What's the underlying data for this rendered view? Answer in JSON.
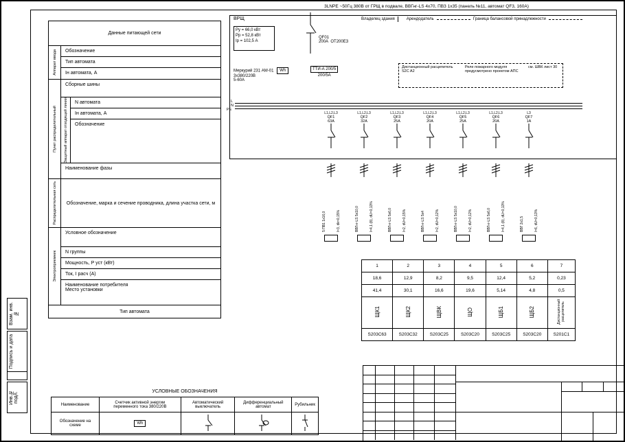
{
  "top_note": "3LNPE ~50Гц 380В от ГРЩ в подвале, ВВГнг-LS 4x70, ПВЗ 1x35 (панель №11, автомат QF3, 160А)",
  "vrd": "ВРЩ",
  "owner": {
    "left": "Владелец здания",
    "right": "Арендодатель",
    "line": "Граница балансовой принадлежности"
  },
  "params": {
    "pu": "Ру = 66,0 кВт",
    "pp": "Рр = 52,8 кВт",
    "ip": "Iр = 102,5 А"
  },
  "qf01": {
    "name": "QF01",
    "rating": "200А",
    "device": "ОТ200Е3"
  },
  "meter": {
    "name": "Меркурий 231 АМ-01",
    "voltage": "3х380/220В",
    "current": "5-60А",
    "wh": "Wh"
  },
  "tt": {
    "name": "ТТИ-А 200/5",
    "ratio": "200/5А"
  },
  "remote": {
    "trip_title": "Дистанционный расцепитель",
    "trip_code": "S2C A2",
    "fire_title": "Реле пожарного модуля предусмотрено проектом АПС",
    "fire_ref": "см. ШВК лист 30"
  },
  "bus_labels": {
    "l": "L",
    "n": "N",
    "pe": "PE"
  },
  "branches": [
    {
      "phases": "L1,L2,L3",
      "qf": "QF1",
      "amp": "63А"
    },
    {
      "phases": "L1,L2,L3",
      "qf": "QF2",
      "amp": "32А"
    },
    {
      "phases": "L1,L2,L3",
      "qf": "QF3",
      "amp": "25А"
    },
    {
      "phases": "L1,L2,L3",
      "qf": "QF4",
      "amp": "20А"
    },
    {
      "phases": "L1,L2,L3",
      "qf": "QF5",
      "amp": "25А"
    },
    {
      "phases": "L1,L2,L3",
      "qf": "QF6",
      "amp": "20А"
    },
    {
      "phases": "L3",
      "qf": "QF7",
      "amp": "1А"
    }
  ],
  "cables": [
    {
      "a": "5 ПВ1 1x16,0",
      "b": "l=3, dk=0,15%"
    },
    {
      "a": "ВВГнг-LS 5x10,0",
      "b": "l=4,1 (8), dU=0,13%"
    },
    {
      "a": "ВВГнг-LS 5x6,0",
      "b": "l=2, dU=0,15%"
    },
    {
      "a": "ВВГнг-LS 5x4",
      "b": "l=2, dU=0,12%"
    },
    {
      "a": "ВВГнг-LS 5x10,0",
      "b": "l=2, dU=0,12%"
    },
    {
      "a": "ВВГнг-LS 5x6,0",
      "b": "l=4,1 (8), dU=0,13%"
    },
    {
      "a": "ВВГ 2x1,5",
      "b": "l=6, dU=0,13%"
    }
  ],
  "table": {
    "cols": [
      "1",
      "2",
      "3",
      "4",
      "5",
      "6",
      "7"
    ],
    "row_p": [
      "18,6",
      "12,9",
      "8,2",
      "9,5",
      "12,4",
      "5,2",
      "0,23"
    ],
    "row_i": [
      "41,4",
      "30,1",
      "16,6",
      "19,6",
      "5,14",
      "4,8",
      "0,5"
    ],
    "row_name": [
      "ЩК1",
      "ЩК2",
      "ЩВК",
      "ЩО",
      "ЩБ1",
      "ЩБ2",
      "Дистанционный расцепитель"
    ],
    "row_code": [
      "S203С63",
      "S203С32",
      "S203С25",
      "S203С20",
      "S203С25",
      "S203С20",
      "S201С1"
    ]
  },
  "left_block": {
    "header": "Данные питающей сети",
    "g1_side": "Аппарат ввода",
    "g1": [
      "Обозначение",
      "Тип автомата",
      "Iн автомата, А"
    ],
    "g2_side": "Пункт распределительный",
    "g2_1": "Сборные шины",
    "g2_sub_side": "Защитный аппарат отходящей линии",
    "g2_sub": [
      "N автомата",
      "Iн автомата, А",
      "Обозначение"
    ],
    "g2_last": "Наименование фазы",
    "g3_side": "Распределительная сеть",
    "g3": "Обозначение, марка и сечение проводника, длина участка сети, м",
    "g4_side": "Электроприемник",
    "g4": [
      "Условное обозначение",
      "N группы",
      "Мощность, Р уст (кВт)",
      "Ток, I расч (А)",
      "Наименование потребителя\nМесто установки"
    ],
    "footer": "Тип автомата"
  },
  "legend": {
    "title": "УСЛОВНЫЕ ОБОЗНАЧЕНИЯ",
    "row1": [
      "Наименование",
      "Счетчик активной энергии переменного тока 380/220В",
      "Автоматический выключатель",
      "Дифференциальный автомат",
      "Рубильник"
    ],
    "row2_label": "Обозначение на схеме",
    "wh": "Wh"
  },
  "side_tabs": [
    "Взам. инв.№",
    "Подпись и дата",
    "Инв.№ подл."
  ]
}
